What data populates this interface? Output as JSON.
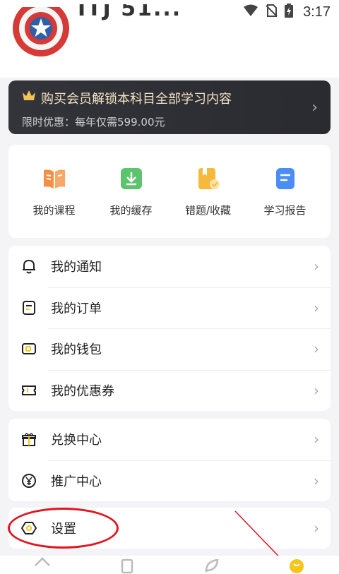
{
  "status_bar": {
    "time": "3:17"
  },
  "profile": {
    "username": "ITJ 51..."
  },
  "vip": {
    "title": "购买会员解锁本科目全部学习内容",
    "subtitle": "限时优惠：每年仅需599.00元"
  },
  "quick_actions": [
    {
      "label": "我的课程",
      "icon": "book-icon",
      "color": "#f49046"
    },
    {
      "label": "我的缓存",
      "icon": "download-icon",
      "color": "#5cc46e"
    },
    {
      "label": "错题/收藏",
      "icon": "bookmark-icon",
      "color": "#f5b93c"
    },
    {
      "label": "学习报告",
      "icon": "report-icon",
      "color": "#4b8df5"
    }
  ],
  "menu1": [
    {
      "label": "我的通知",
      "icon": "bell-icon"
    },
    {
      "label": "我的订单",
      "icon": "order-icon"
    },
    {
      "label": "我的钱包",
      "icon": "wallet-icon"
    },
    {
      "label": "我的优惠券",
      "icon": "coupon-icon"
    }
  ],
  "menu2": [
    {
      "label": "兑换中心",
      "icon": "gift-icon"
    },
    {
      "label": "推广中心",
      "icon": "yen-icon"
    }
  ],
  "menu3": [
    {
      "label": "设置",
      "icon": "settings-icon"
    }
  ],
  "colors": {
    "accent": "#f5c518",
    "annotation": "#e0161f",
    "banner": "#2f3035"
  }
}
